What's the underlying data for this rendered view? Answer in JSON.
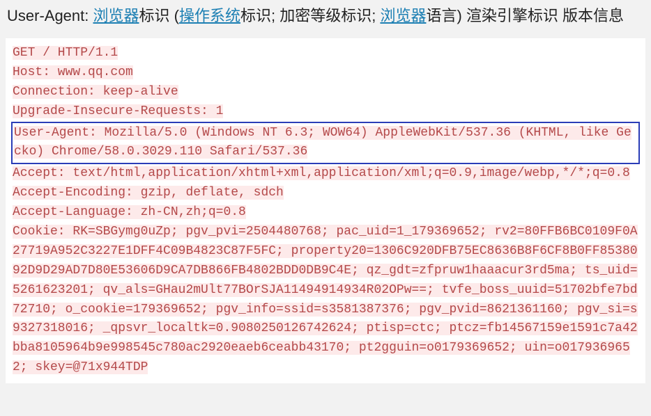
{
  "header": {
    "prefix": "User-Agent: ",
    "link1": "浏览器",
    "t1": "标识 (",
    "link2": "操作系统",
    "t2": "标识; 加密等级标识; ",
    "link3": "浏览器",
    "t3": "语言) 渲染引擎标识 版本信息"
  },
  "http": {
    "l1": "GET / HTTP/1.1",
    "l2": "Host: www.qq.com",
    "l3": "Connection: keep-alive",
    "l4": "Upgrade-Insecure-Requests: 1",
    "ua": "User-Agent: Mozilla/5.0 (Windows NT 6.3; WOW64) AppleWebKit/537.36 (KHTML, like Gecko) Chrome/58.0.3029.110 Safari/537.36",
    "l6": "Accept: text/html,application/xhtml+xml,application/xml;q=0.9,image/webp,*/*;q=0.8",
    "l7": "Accept-Encoding: gzip, deflate, sdch",
    "l8": "Accept-Language: zh-CN,zh;q=0.8",
    "cookie": "Cookie: RK=SBGymg0uZp; pgv_pvi=2504480768; pac_uid=1_179369652; rv2=80FFB6BC0109F0A27719A952C3227E1DFF4C09B4823C87F5FC; property20=1306C920DFB75EC8636B8F6CF8B0FF8538092D9D29AD7D80E53606D9CA7DB866FB4802BDD0DB9C4E; qz_gdt=zfpruw1haaacur3rd5ma; ts_uid=5261623201; qv_als=GHau2mUlt77BOrSJA11494914934R02OPw==; tvfe_boss_uuid=51702bfe7bd72710; o_cookie=179369652; pgv_info=ssid=s3581387376; pgv_pvid=8621361160; pgv_si=s9327318016; _qpsvr_localtk=0.9080250126742624; ptisp=ctc; ptcz=fb14567159e1591c7a42bba8105964b9e998545c780ac2920eaeb6ceabb43170; pt2gguin=o0179369652; uin=o0179369652; skey=@71x944TDP"
  }
}
